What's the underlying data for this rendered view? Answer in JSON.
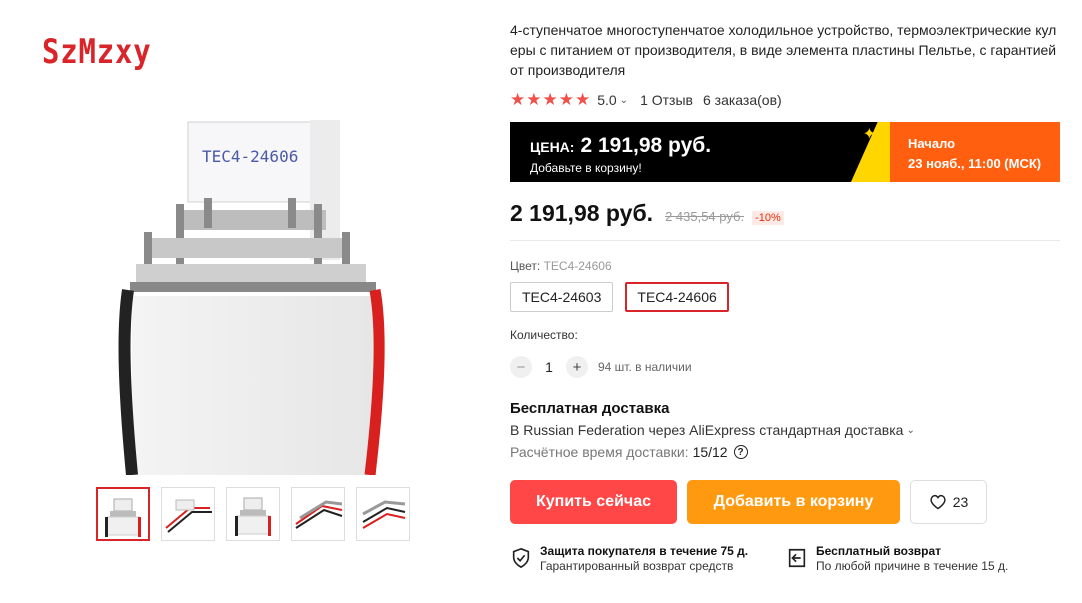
{
  "brand": {
    "logo_text": "SzMzxy",
    "color": "#d9252a"
  },
  "product": {
    "title": "4-ступенчатое многоступенчатое холодильное устройство, термоэлектрические кулеры с питанием от производителя, в виде элемента пластины Пельтье, с гарантией от производителя",
    "image_label": "TEC4-24606",
    "thumbnails": [
      {
        "icon": "peltier-stack-photo"
      },
      {
        "icon": "peltier-wires-photo"
      },
      {
        "icon": "peltier-stack-photo"
      },
      {
        "icon": "peltier-wires-photo"
      },
      {
        "icon": "peltier-wires-photo"
      }
    ]
  },
  "rating": {
    "stars": "★★★★★",
    "value": "5.0",
    "reviews": "1 Отзыв",
    "orders": "6 заказа(ов)",
    "star_color": "#f0514b"
  },
  "promo": {
    "price_label": "ЦЕНА:",
    "price": "2 191,98 руб.",
    "subtitle": "Добавьте в корзину!",
    "start_label": "Начало",
    "start_time": "23 нояб., 11:00 (МСК)",
    "colors": {
      "dark": "#000000",
      "accent": "#ff5f0e",
      "stripe": "#ffd600"
    }
  },
  "price": {
    "current": "2 191,98 руб.",
    "old": "2 435,54 руб.",
    "discount": "-10%"
  },
  "color_option": {
    "label": "Цвет:",
    "selected": "TEC4-24606",
    "options": [
      "TEC4-24603",
      "TEC4-24606"
    ]
  },
  "quantity": {
    "label": "Количество:",
    "value": "1",
    "minus": "−",
    "plus": "+",
    "stock": "94 шт. в наличии"
  },
  "shipping": {
    "title": "Бесплатная доставка",
    "method": "В Russian Federation через AliExpress стандартная доставка",
    "time_label": "Расчётное время доставки:",
    "time_value": "15/12",
    "help": "?"
  },
  "actions": {
    "buy_now": "Купить сейчас",
    "add_to_cart": "Добавить в корзину",
    "wishlist_count": "23",
    "buy_color": "#ff4747",
    "cart_color": "#ff9a10"
  },
  "guarantees": [
    {
      "icon": "shield-check-icon",
      "title": "Защита покупателя в течение 75 д.",
      "subtitle": "Гарантированный возврат средств"
    },
    {
      "icon": "return-arrow-icon",
      "title": "Бесплатный возврат",
      "subtitle": "По любой причине в течение 15 д."
    }
  ]
}
